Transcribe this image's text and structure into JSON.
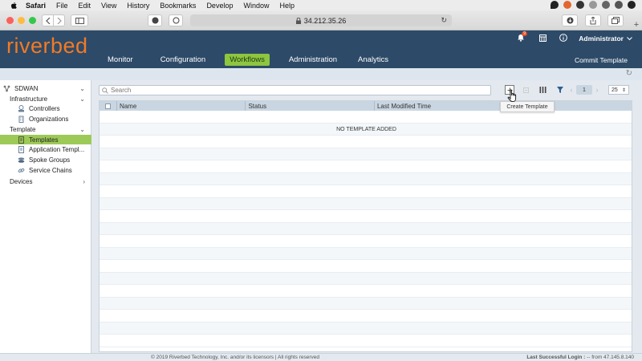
{
  "mac_menu": {
    "items": [
      "Safari",
      "File",
      "Edit",
      "View",
      "History",
      "Bookmarks",
      "Develop",
      "Window",
      "Help"
    ]
  },
  "browser": {
    "url": "34.212.35.26"
  },
  "app": {
    "logo": "riverbed",
    "nav": [
      {
        "label": "Monitor",
        "active": false
      },
      {
        "label": "Configuration",
        "active": false
      },
      {
        "label": "Workflows",
        "active": true
      },
      {
        "label": "Administration",
        "active": false
      },
      {
        "label": "Analytics",
        "active": false
      }
    ],
    "notification_count": "9",
    "user": "Administrator",
    "commit_label": "Commit Template"
  },
  "sidebar": {
    "root": "SDWAN",
    "items": [
      {
        "label": "Infrastructure",
        "level": 0,
        "chevron": "down",
        "icon": ""
      },
      {
        "label": "Controllers",
        "level": 1,
        "icon": "controllers-icon"
      },
      {
        "label": "Organizations",
        "level": 1,
        "icon": "organizations-icon"
      },
      {
        "label": "Template",
        "level": 0,
        "chevron": "down",
        "icon": ""
      },
      {
        "label": "Templates",
        "level": 1,
        "icon": "templates-icon",
        "selected": true
      },
      {
        "label": "Application Templ...",
        "level": 1,
        "icon": "application-templates-icon"
      },
      {
        "label": "Spoke Groups",
        "level": 1,
        "icon": "spoke-groups-icon"
      },
      {
        "label": "Service Chains",
        "level": 1,
        "icon": "service-chains-icon"
      },
      {
        "label": "Devices",
        "level": 0,
        "chevron": "right",
        "icon": ""
      }
    ]
  },
  "grid": {
    "search_placeholder": "Search",
    "columns": [
      "Name",
      "Status",
      "Last Modified Time"
    ],
    "empty_message": "NO TEMPLATE ADDED",
    "page": "1",
    "page_size": "25",
    "tooltip": "Create Template"
  },
  "footer": {
    "copyright": "© 2019 Riverbed Technology, Inc. and/or its licensors | All rights reserved",
    "login_label": "Last Successful Login :",
    "login_value": " -- from 47.145.8.140"
  },
  "colors": {
    "header": "#2d4a68",
    "brand": "#f27a25",
    "active_tab": "#8dc63f",
    "selected_item": "#9dc957"
  }
}
